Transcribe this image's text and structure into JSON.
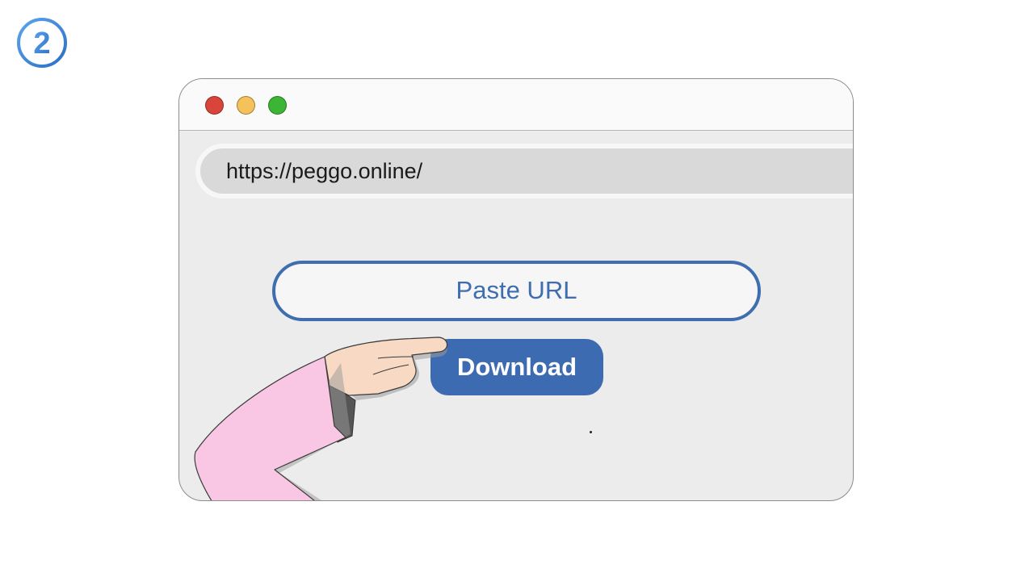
{
  "step": {
    "number": "2",
    "icon": "step-number-icon",
    "color": "#3d86d6"
  },
  "browser": {
    "window_controls": [
      {
        "name": "close",
        "color": "#d9453a"
      },
      {
        "name": "minimize",
        "color": "#f5c15a"
      },
      {
        "name": "maximize",
        "color": "#3db534"
      }
    ],
    "address_bar": {
      "url": "https://peggo.online/"
    }
  },
  "page": {
    "paste_field": {
      "placeholder": "Paste URL"
    },
    "download_button": {
      "label": "Download",
      "color": "#3d6bb2"
    },
    "illustration": {
      "icon": "pointing-hand-icon",
      "sleeve_color": "#f9c6e4",
      "skin_color": "#f7d9c4"
    }
  }
}
